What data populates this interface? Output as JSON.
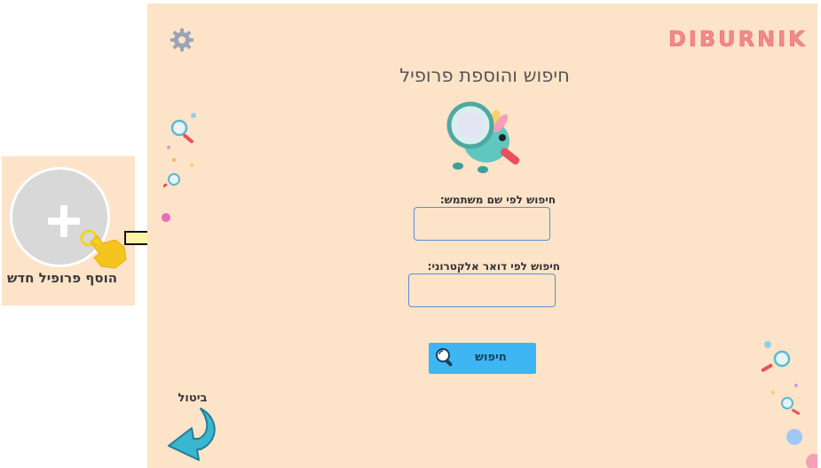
{
  "inset": {
    "add_profile_label": "הוסף פרופיל חדש",
    "add_icon": "plus-icon",
    "hand_icon": "pointing-hand-icon",
    "arrow_icon": "right-arrow-icon"
  },
  "header": {
    "settings_icon": "gear-icon",
    "logo_text": "DIBURNIK"
  },
  "main": {
    "title": "חיפוש והוספת פרופיל",
    "mascot": "magnifier-mascot",
    "username_label": "חיפוש לפי שם משתמש:",
    "username_value": "",
    "email_label": "חיפוש לפי דואר אלקטרוני:",
    "email_value": "",
    "search_button_label": "חיפוש",
    "search_icon": "magnifier-icon"
  },
  "footer": {
    "cancel_label": "ביטול",
    "back_icon": "curved-back-arrow-icon"
  },
  "colors": {
    "background": "#fde3c8",
    "logo": "#f08a8a",
    "button": "#3eb6f4",
    "field_border": "#5b8fd6",
    "title": "#555555"
  }
}
